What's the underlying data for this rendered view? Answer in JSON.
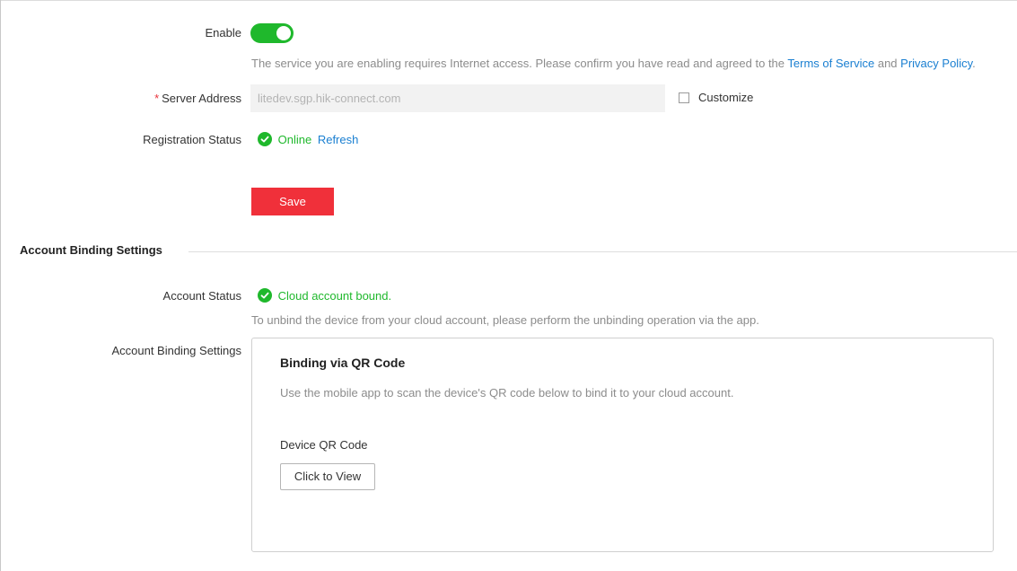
{
  "service": {
    "enable_label": "Enable",
    "enabled": true,
    "notice_text": "The service you are enabling requires Internet access. Please confirm you have read and agreed to the",
    "terms_link": "Terms of Service",
    "and_text": "and",
    "privacy_link": "Privacy Policy",
    "notice_end": ".",
    "server_address_required": "*",
    "server_address_label": "Server Address",
    "server_address_value": "litedev.sgp.hik-connect.com",
    "customize_label": "Customize",
    "registration_status_label": "Registration Status",
    "registration_status_value": "Online",
    "refresh_link": "Refresh",
    "save_button": "Save"
  },
  "account_binding": {
    "section_title": "Account Binding Settings",
    "account_status_label": "Account Status",
    "account_status_value": "Cloud account bound.",
    "unbind_hint": "To unbind the device from your cloud account, please perform the unbinding operation via the app.",
    "settings_label": "Account Binding Settings",
    "panel": {
      "title": "Binding via QR Code",
      "description": "Use the mobile app to scan the device's QR code below to bind it to your cloud account.",
      "qr_label": "Device QR Code",
      "view_button": "Click to View"
    }
  },
  "colors": {
    "accent_green": "#1fb82c",
    "link_blue": "#1a7fd1",
    "danger_red": "#f0303a"
  }
}
